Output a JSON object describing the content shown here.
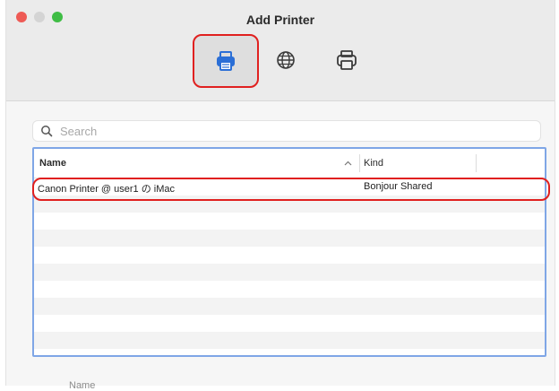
{
  "window": {
    "title": "Add Printer"
  },
  "toolbar": {
    "items": [
      {
        "name": "default",
        "icon": "printer-icon",
        "selected": true
      },
      {
        "name": "ip",
        "icon": "globe-icon",
        "selected": false
      },
      {
        "name": "windows",
        "icon": "printer-icon",
        "selected": false
      }
    ]
  },
  "search": {
    "placeholder": "Search",
    "value": ""
  },
  "table": {
    "columns": [
      "Name",
      "Kind"
    ],
    "sort_indicator": "^",
    "rows": [
      {
        "name": "Canon Printer @ user1 の iMac",
        "kind": "Bonjour Shared"
      }
    ],
    "empty_row_count": 9
  },
  "footer": {
    "label": "Name"
  },
  "colors": {
    "highlight": "#e0201f",
    "table_border": "#7fa6e6",
    "close": "#ee5a55",
    "maximize": "#3fbd45"
  }
}
